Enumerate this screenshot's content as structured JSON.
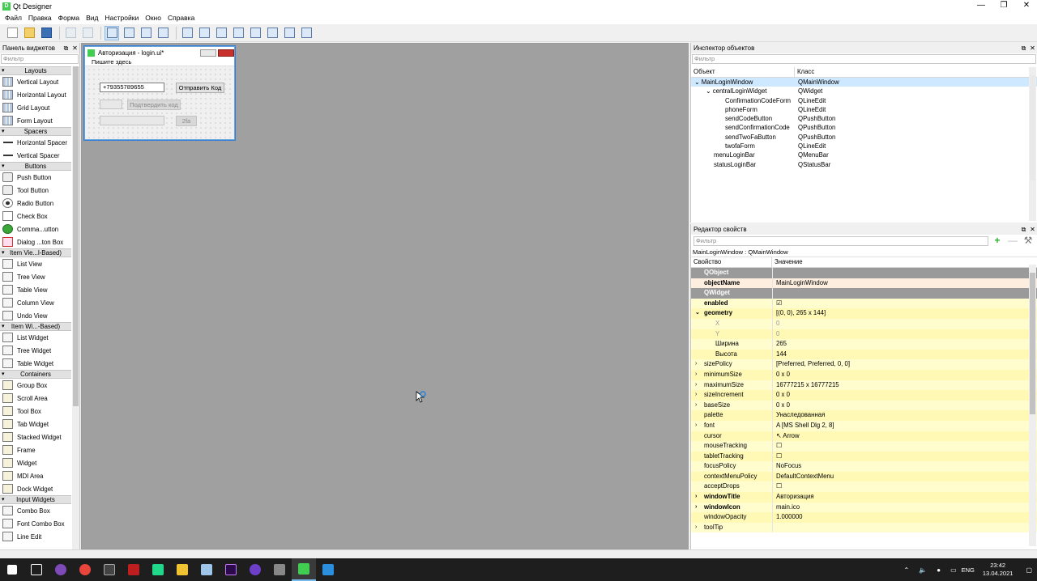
{
  "window": {
    "title": "Qt Designer"
  },
  "menu": [
    "Файл",
    "Правка",
    "Форма",
    "Вид",
    "Настройки",
    "Окно",
    "Справка"
  ],
  "widget_box": {
    "title": "Панель виджетов",
    "filter_placeholder": "Фильтр",
    "categories": [
      {
        "name": "Layouts",
        "items": [
          [
            "Vertical Layout",
            "lay"
          ],
          [
            "Horizontal Layout",
            "lay"
          ],
          [
            "Grid Layout",
            "lay"
          ],
          [
            "Form Layout",
            "lay"
          ]
        ]
      },
      {
        "name": "Spacers",
        "items": [
          [
            "Horizontal Spacer",
            "sp"
          ],
          [
            "Vertical Spacer",
            "sp"
          ]
        ]
      },
      {
        "name": "Buttons",
        "items": [
          [
            "Push Button",
            "btn"
          ],
          [
            "Tool Button",
            "btn"
          ],
          [
            "Radio Button",
            "rad"
          ],
          [
            "Check Box",
            "chk"
          ],
          [
            "Comma...utton",
            "cmd"
          ],
          [
            "Dialog ...ton Box",
            "dlg"
          ]
        ]
      },
      {
        "name": "Item Vie...l-Based)",
        "items": [
          [
            "List View",
            "view"
          ],
          [
            "Tree View",
            "view"
          ],
          [
            "Table View",
            "view"
          ],
          [
            "Column View",
            "view"
          ],
          [
            "Undo View",
            "view"
          ]
        ]
      },
      {
        "name": "Item Wi...-Based)",
        "items": [
          [
            "List Widget",
            "view"
          ],
          [
            "Tree Widget",
            "view"
          ],
          [
            "Table Widget",
            "view"
          ]
        ]
      },
      {
        "name": "Containers",
        "items": [
          [
            "Group Box",
            "cont"
          ],
          [
            "Scroll Area",
            "cont"
          ],
          [
            "Tool Box",
            "cont"
          ],
          [
            "Tab Widget",
            "cont"
          ],
          [
            "Stacked Widget",
            "cont"
          ],
          [
            "Frame",
            "cont"
          ],
          [
            "Widget",
            "cont"
          ],
          [
            "MDI Area",
            "cont"
          ],
          [
            "Dock Widget",
            "cont"
          ]
        ]
      },
      {
        "name": "Input Widgets",
        "items": [
          [
            "Combo Box",
            "view"
          ],
          [
            "Font Combo Box",
            "view"
          ],
          [
            "Line Edit",
            "view"
          ]
        ]
      }
    ]
  },
  "form": {
    "title": "Авторизация - login.ui*",
    "menu_placeholder": "Пишите здесь",
    "phone_value": "+79355789655",
    "send_code": "Отправить Код",
    "confirm_code": "Подтвердить код",
    "twofa": "2fa"
  },
  "inspector": {
    "title": "Инспектор объектов",
    "filter_placeholder": "Фильтр",
    "col_object": "Объект",
    "col_class": "Класс",
    "rows": [
      {
        "object": "MainLoginWindow",
        "class": "QMainWindow",
        "depth": 0,
        "exp": "v"
      },
      {
        "object": "centralLoginWidget",
        "class": "QWidget",
        "depth": 1,
        "exp": "v"
      },
      {
        "object": "ConfirmationCodeForm",
        "class": "QLineEdit",
        "depth": 2,
        "exp": ""
      },
      {
        "object": "phoneForm",
        "class": "QLineEdit",
        "depth": 2,
        "exp": ""
      },
      {
        "object": "sendCodeButton",
        "class": "QPushButton",
        "depth": 2,
        "exp": ""
      },
      {
        "object": "sendConfirmationCode",
        "class": "QPushButton",
        "depth": 2,
        "exp": ""
      },
      {
        "object": "sendTwoFaButton",
        "class": "QPushButton",
        "depth": 2,
        "exp": ""
      },
      {
        "object": "twofaForm",
        "class": "QLineEdit",
        "depth": 2,
        "exp": ""
      },
      {
        "object": "menuLoginBar",
        "class": "QMenuBar",
        "depth": 1,
        "exp": ""
      },
      {
        "object": "statusLoginBar",
        "class": "QStatusBar",
        "depth": 1,
        "exp": ""
      }
    ]
  },
  "property_editor": {
    "title": "Редактор свойств",
    "filter_placeholder": "Фильтр",
    "object_line": "MainLoginWindow : QMainWindow",
    "col_property": "Свойство",
    "col_value": "Значение",
    "rows": [
      {
        "k": "QObject",
        "v": "",
        "t": "hd"
      },
      {
        "k": "objectName",
        "v": "MainLoginWindow",
        "t": "o0 bold"
      },
      {
        "k": "QWidget",
        "v": "",
        "t": "hd"
      },
      {
        "k": "enabled",
        "v": "☑",
        "t": "y0 bold",
        "cb": true
      },
      {
        "k": "geometry",
        "v": "[(0, 0), 265 x 144]",
        "t": "y1 bold",
        "ex": "v"
      },
      {
        "k": "X",
        "v": "0",
        "t": "y0 sub ro"
      },
      {
        "k": "Y",
        "v": "0",
        "t": "y1 sub ro"
      },
      {
        "k": "Ширина",
        "v": "265",
        "t": "y0 sub"
      },
      {
        "k": "Высота",
        "v": "144",
        "t": "y1 sub"
      },
      {
        "k": "sizePolicy",
        "v": "[Preferred, Preferred, 0, 0]",
        "t": "y0",
        "ex": ">"
      },
      {
        "k": "minimumSize",
        "v": "0 x 0",
        "t": "y1",
        "ex": ">"
      },
      {
        "k": "maximumSize",
        "v": "16777215 x 16777215",
        "t": "y0",
        "ex": ">"
      },
      {
        "k": "sizeIncrement",
        "v": "0 x 0",
        "t": "y1",
        "ex": ">"
      },
      {
        "k": "baseSize",
        "v": "0 x 0",
        "t": "y0",
        "ex": ">"
      },
      {
        "k": "palette",
        "v": "Унаследованная",
        "t": "y1"
      },
      {
        "k": "font",
        "v": "A  [MS Shell Dlg 2, 8]",
        "t": "y0",
        "ex": ">"
      },
      {
        "k": "cursor",
        "v": "↖  Arrow",
        "t": "y1"
      },
      {
        "k": "mouseTracking",
        "v": "☐",
        "t": "y0",
        "cb": true
      },
      {
        "k": "tabletTracking",
        "v": "☐",
        "t": "y1",
        "cb": true
      },
      {
        "k": "focusPolicy",
        "v": "NoFocus",
        "t": "y0"
      },
      {
        "k": "contextMenuPolicy",
        "v": "DefaultContextMenu",
        "t": "y1"
      },
      {
        "k": "acceptDrops",
        "v": "☐",
        "t": "y0",
        "cb": true
      },
      {
        "k": "windowTitle",
        "v": "Авторизация",
        "t": "y1 bold",
        "ex": ">"
      },
      {
        "k": "windowIcon",
        "v": "main.ico",
        "t": "y0 bold",
        "ex": ">"
      },
      {
        "k": "windowOpacity",
        "v": "1.000000",
        "t": "y1"
      },
      {
        "k": "toolTip",
        "v": "",
        "t": "y0",
        "ex": ">"
      }
    ]
  },
  "tray": {
    "lang": "ENG",
    "time": "23:42",
    "date": "13.04.2021"
  }
}
